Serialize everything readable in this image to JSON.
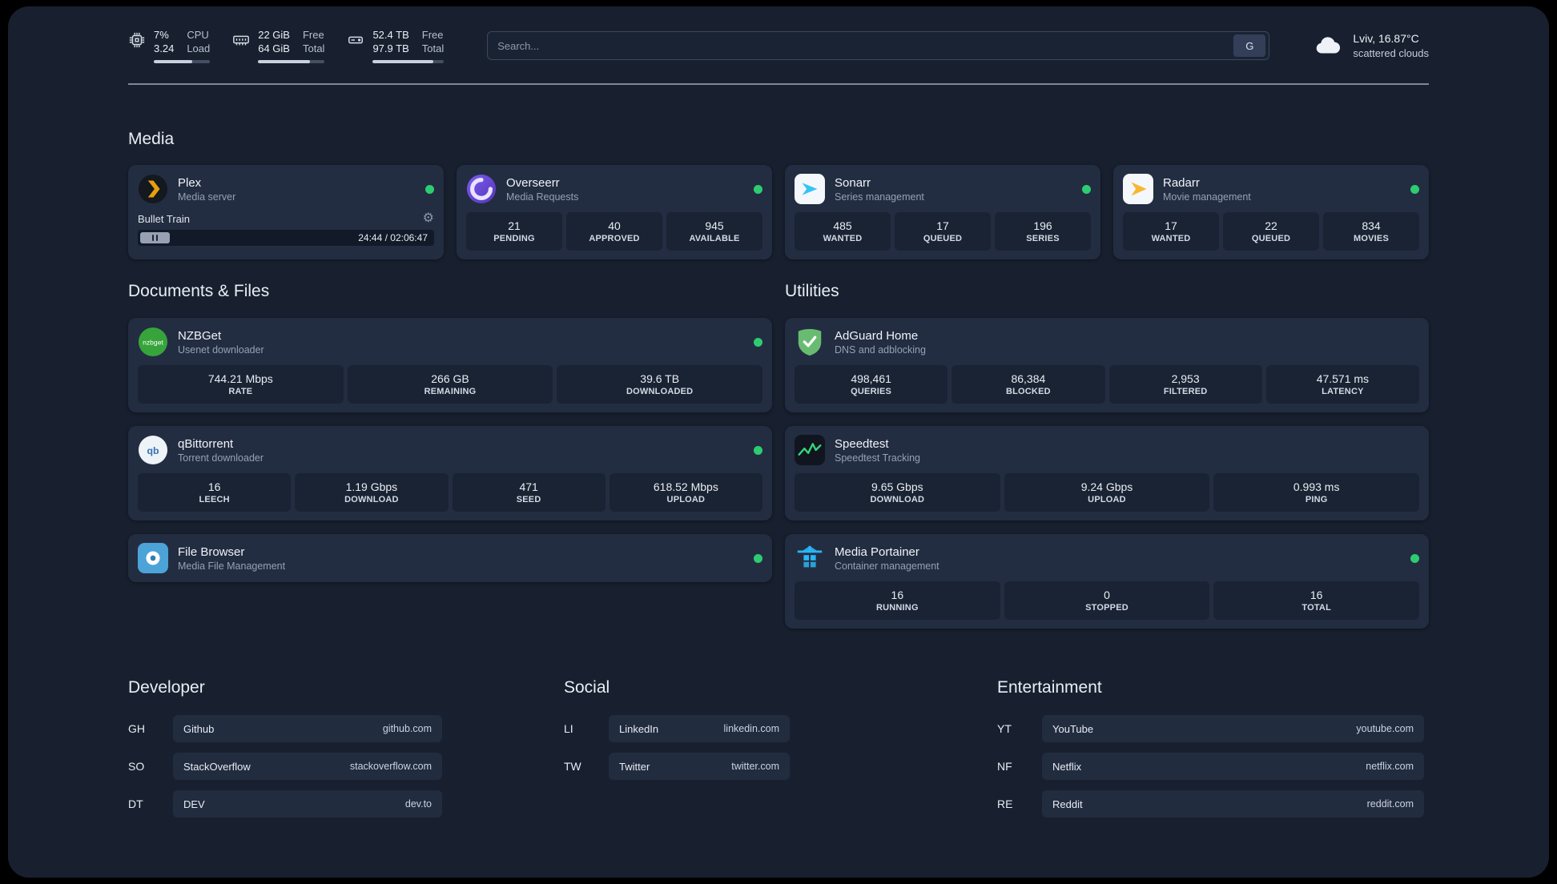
{
  "colors": {
    "status_online": "#2ecc71"
  },
  "topbar": {
    "cpu": {
      "icon": "cpu-chip-icon",
      "values": [
        "7%",
        "3.24"
      ],
      "labels": [
        "CPU",
        "Load"
      ],
      "bar_fill": "68%"
    },
    "ram": {
      "icon": "memory-icon",
      "values": [
        "22 GiB",
        "64 GiB"
      ],
      "labels": [
        "Free",
        "Total"
      ],
      "bar_fill": "78%"
    },
    "disk": {
      "icon": "hard-drive-icon",
      "values": [
        "52.4 TB",
        "97.9 TB"
      ],
      "labels": [
        "Free",
        "Total"
      ],
      "bar_fill": "85%"
    },
    "search": {
      "placeholder": "Search...",
      "engine_label": "G"
    },
    "weather": {
      "icon": "cloud-icon",
      "location": "Lviv, 16.87°C",
      "condition": "scattered clouds"
    }
  },
  "sections": {
    "media": {
      "title": "Media",
      "apps": [
        {
          "name": "Plex",
          "subtitle": "Media server",
          "icon": "plex-icon",
          "online": true,
          "player": {
            "title": "Bullet Train",
            "time": "24:44 / 02:06:47",
            "progress": "10%"
          }
        },
        {
          "name": "Overseerr",
          "subtitle": "Media Requests",
          "icon": "overseerr-icon",
          "online": true,
          "stats": [
            {
              "value": "21",
              "label": "PENDING"
            },
            {
              "value": "40",
              "label": "APPROVED"
            },
            {
              "value": "945",
              "label": "AVAILABLE"
            }
          ]
        },
        {
          "name": "Sonarr",
          "subtitle": "Series management",
          "icon": "sonarr-icon",
          "online": true,
          "stats": [
            {
              "value": "485",
              "label": "WANTED"
            },
            {
              "value": "17",
              "label": "QUEUED"
            },
            {
              "value": "196",
              "label": "SERIES"
            }
          ]
        },
        {
          "name": "Radarr",
          "subtitle": "Movie management",
          "icon": "radarr-icon",
          "online": true,
          "stats": [
            {
              "value": "17",
              "label": "WANTED"
            },
            {
              "value": "22",
              "label": "QUEUED"
            },
            {
              "value": "834",
              "label": "MOVIES"
            }
          ]
        }
      ]
    },
    "documents": {
      "title": "Documents & Files",
      "apps": [
        {
          "name": "NZBGet",
          "subtitle": "Usenet downloader",
          "icon": "nzbget-icon",
          "online": true,
          "stats": [
            {
              "value": "744.21 Mbps",
              "label": "RATE"
            },
            {
              "value": "266 GB",
              "label": "REMAINING"
            },
            {
              "value": "39.6 TB",
              "label": "DOWNLOADED"
            }
          ]
        },
        {
          "name": "qBittorrent",
          "subtitle": "Torrent downloader",
          "icon": "qbittorrent-icon",
          "online": true,
          "stats": [
            {
              "value": "16",
              "label": "LEECH"
            },
            {
              "value": "1.19 Gbps",
              "label": "DOWNLOAD"
            },
            {
              "value": "471",
              "label": "SEED"
            },
            {
              "value": "618.52 Mbps",
              "label": "UPLOAD"
            }
          ]
        },
        {
          "name": "File Browser",
          "subtitle": "Media File Management",
          "icon": "filebrowser-icon",
          "online": true,
          "stats": []
        }
      ]
    },
    "utilities": {
      "title": "Utilities",
      "apps": [
        {
          "name": "AdGuard Home",
          "subtitle": "DNS and adblocking",
          "icon": "adguard-icon",
          "online": false,
          "stats": [
            {
              "value": "498,461",
              "label": "QUERIES"
            },
            {
              "value": "86,384",
              "label": "BLOCKED"
            },
            {
              "value": "2,953",
              "label": "FILTERED"
            },
            {
              "value": "47.571 ms",
              "label": "LATENCY"
            }
          ]
        },
        {
          "name": "Speedtest",
          "subtitle": "Speedtest Tracking",
          "icon": "speedtest-icon",
          "online": false,
          "stats": [
            {
              "value": "9.65 Gbps",
              "label": "DOWNLOAD"
            },
            {
              "value": "9.24 Gbps",
              "label": "UPLOAD"
            },
            {
              "value": "0.993 ms",
              "label": "PING"
            }
          ]
        },
        {
          "name": "Media Portainer",
          "subtitle": "Container management",
          "icon": "portainer-icon",
          "online": true,
          "stats": [
            {
              "value": "16",
              "label": "RUNNING"
            },
            {
              "value": "0",
              "label": "STOPPED"
            },
            {
              "value": "16",
              "label": "TOTAL"
            }
          ]
        }
      ]
    }
  },
  "bookmarks": {
    "developer": {
      "title": "Developer",
      "items": [
        {
          "abbr": "GH",
          "name": "Github",
          "url": "github.com"
        },
        {
          "abbr": "SO",
          "name": "StackOverflow",
          "url": "stackoverflow.com"
        },
        {
          "abbr": "DT",
          "name": "DEV",
          "url": "dev.to"
        }
      ]
    },
    "social": {
      "title": "Social",
      "items": [
        {
          "abbr": "LI",
          "name": "LinkedIn",
          "url": "linkedin.com"
        },
        {
          "abbr": "TW",
          "name": "Twitter",
          "url": "twitter.com"
        }
      ]
    },
    "entertainment": {
      "title": "Entertainment",
      "items": [
        {
          "abbr": "YT",
          "name": "YouTube",
          "url": "youtube.com"
        },
        {
          "abbr": "NF",
          "name": "Netflix",
          "url": "netflix.com"
        },
        {
          "abbr": "RE",
          "name": "Reddit",
          "url": "reddit.com"
        }
      ]
    }
  }
}
